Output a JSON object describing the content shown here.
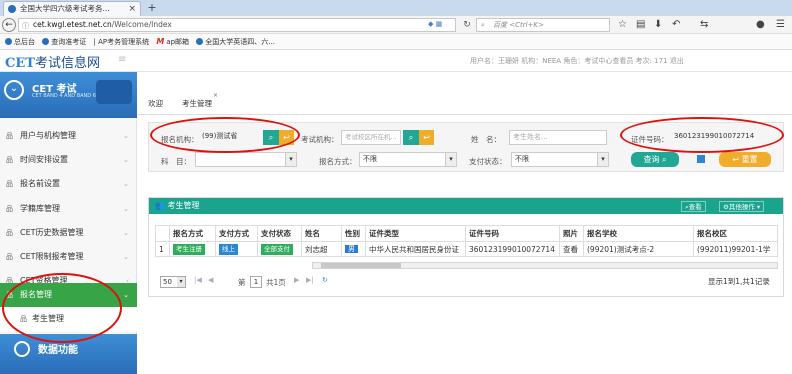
{
  "browser": {
    "tab_title": "全国大学四六级考试考务...",
    "tab_close": "×",
    "new_tab": "+",
    "url_host": "cet.kwgl.etest.net.cn",
    "url_path": "/Welcome/Index",
    "search_placeholder": "百度 <Ctrl+K>"
  },
  "bookmarks": [
    {
      "label": "总后台"
    },
    {
      "label": "查询准考证"
    },
    {
      "label": "AP考务管理系统"
    },
    {
      "label": "ap邮箱",
      "icon": "m"
    },
    {
      "label": "全国大学英语四、六..."
    }
  ],
  "app": {
    "logo_prefix": "CET",
    "logo_text": "考试信息网",
    "user_info": "用户名：王珊妍   机构：NEEA   角色：考试中心查看员   考次: 171   退出"
  },
  "sidebar": {
    "brand_title": "CET 考试",
    "brand_sub": "CET BAND 4 AND BAND 6",
    "items": [
      {
        "label": "用户与机构管理"
      },
      {
        "label": "时间安排设置"
      },
      {
        "label": "报名前设置"
      },
      {
        "label": "学籍库管理"
      },
      {
        "label": "CET历史数据管理"
      },
      {
        "label": "CET限制报考管理"
      },
      {
        "label": "CET资格管理"
      },
      {
        "label": "报名管理"
      },
      {
        "label": "考生管理"
      }
    ],
    "data_title": "数据功能"
  },
  "page_tabs": [
    {
      "label": "欢迎"
    },
    {
      "label": "考生管理"
    }
  ],
  "filter": {
    "org_label": "报名机构：",
    "org_value": "(99)测试省",
    "campus_label": "考试机构：",
    "campus_placeholder": "考试校区所在机...",
    "name_label": "姓　名：",
    "name_placeholder": "考生姓名...",
    "id_label": "证件号码：",
    "id_value": "360123199010072714",
    "subject_label": "科　目：",
    "method_label": "报名方式：",
    "method_value": "不限",
    "pay_label": "支付状态：",
    "pay_value": "不限",
    "search_label": "查询",
    "reset_label": "重置"
  },
  "panel": {
    "title": "考生管理",
    "view_label": "查看",
    "more_label": "其他操作"
  },
  "table": {
    "headers": [
      "",
      "报名方式",
      "支付方式",
      "支付状态",
      "姓名",
      "性别",
      "证件类型",
      "证件号码",
      "照片",
      "报名学校",
      "报名校区"
    ],
    "rows": [
      [
        "1",
        "考生注册",
        "线上",
        "全部支付",
        "刘志超",
        "男",
        "中华人民共和国居民身份证",
        "360123199010072714",
        "查看",
        "(99201)测试考点-2",
        "(992011)99201-1学"
      ]
    ]
  },
  "pager": {
    "page_size": "50",
    "page_prefix": "第",
    "page_num": "1",
    "page_suffix": "共1页",
    "summary": "显示1到1,共1记录"
  }
}
